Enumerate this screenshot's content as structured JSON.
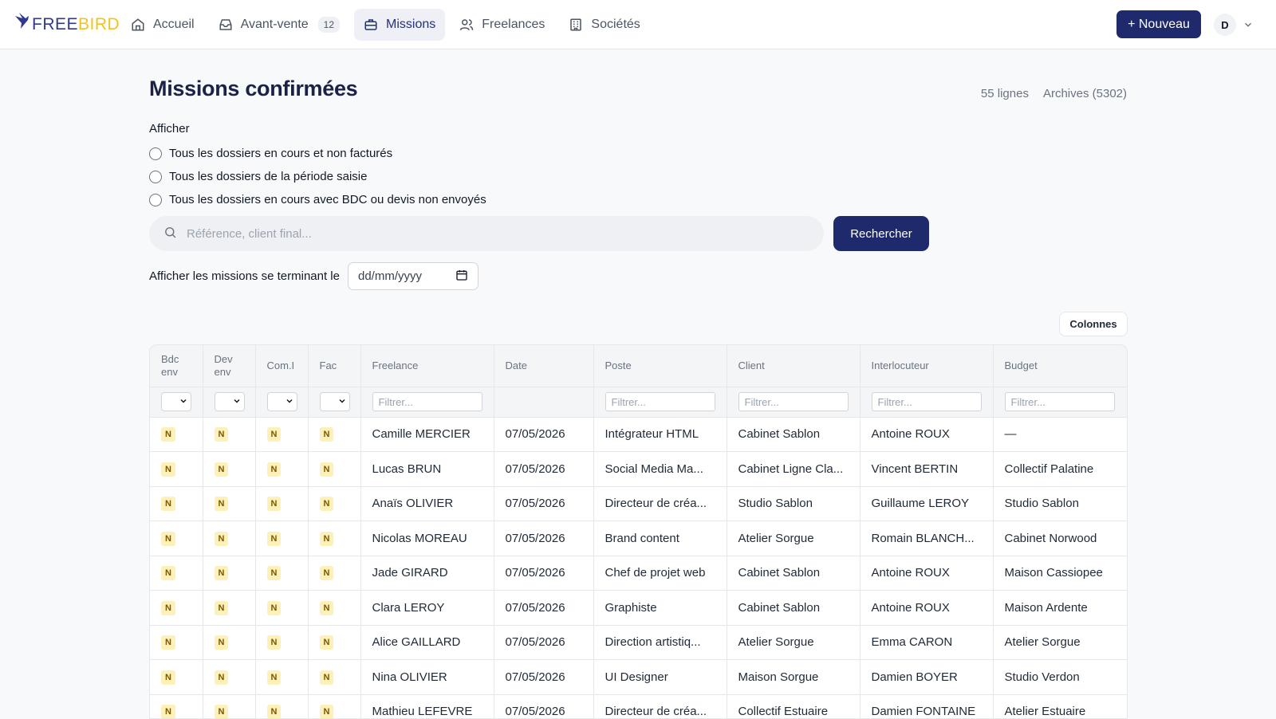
{
  "brand": {
    "free": "FREE",
    "bird": "BIRD"
  },
  "nav": {
    "items": [
      {
        "label": "Accueil",
        "icon": "home-icon"
      },
      {
        "label": "Avant-vente",
        "icon": "inbox-icon",
        "badge": "12"
      },
      {
        "label": "Missions",
        "icon": "briefcase-icon",
        "active": true
      },
      {
        "label": "Freelances",
        "icon": "users-icon"
      },
      {
        "label": "Sociétés",
        "icon": "building-icon"
      }
    ],
    "new_button": "+ Nouveau",
    "avatar": "D"
  },
  "page": {
    "title": "Missions confirmées",
    "rows_count": "55 lignes",
    "archives": "Archives (5302)",
    "afficher": "Afficher",
    "radios": [
      "Tous les dossiers en cours et non facturés",
      "Tous les dossiers de la période saisie",
      "Tous les dossiers en cours avec BDC ou devis non envoyés"
    ],
    "search_placeholder": "Référence, client final...",
    "search_button": "Rechercher",
    "date_label": "Afficher les missions se terminant le",
    "date_placeholder": "dd/mm/yyyy",
    "columns_button": "Colonnes"
  },
  "table": {
    "headers": [
      "Bdc env",
      "Dev env",
      "Com.I",
      "Fac",
      "Freelance",
      "Date",
      "Poste",
      "Client",
      "Interlocuteur",
      "Budget"
    ],
    "filter_placeholder": "Filtrer...",
    "rows": [
      {
        "flags": [
          "N",
          "N",
          "N",
          "N"
        ],
        "freelance": "Camille MERCIER",
        "date": "07/05/2026",
        "poste": "Intégrateur HTML",
        "client": "Cabinet Sablon",
        "interlocuteur": "Antoine ROUX",
        "budget": "—"
      },
      {
        "flags": [
          "N",
          "N",
          "N",
          "N"
        ],
        "freelance": "Lucas BRUN",
        "date": "07/05/2026",
        "poste": "Social Media Ma...",
        "client": "Cabinet Ligne Cla...",
        "interlocuteur": "Vincent BERTIN",
        "budget": "Collectif Palatine"
      },
      {
        "flags": [
          "N",
          "N",
          "N",
          "N"
        ],
        "freelance": "Anaïs OLIVIER",
        "date": "07/05/2026",
        "poste": "Directeur de créa...",
        "client": "Studio Sablon",
        "interlocuteur": "Guillaume LEROY",
        "budget": "Studio Sablon"
      },
      {
        "flags": [
          "N",
          "N",
          "N",
          "N"
        ],
        "freelance": "Nicolas MOREAU",
        "date": "07/05/2026",
        "poste": "Brand content",
        "client": "Atelier Sorgue",
        "interlocuteur": "Romain BLANCH...",
        "budget": "Cabinet Norwood"
      },
      {
        "flags": [
          "N",
          "N",
          "N",
          "N"
        ],
        "freelance": "Jade GIRARD",
        "date": "07/05/2026",
        "poste": "Chef de projet web",
        "client": "Cabinet Sablon",
        "interlocuteur": "Antoine ROUX",
        "budget": "Maison Cassiopee"
      },
      {
        "flags": [
          "N",
          "N",
          "N",
          "N"
        ],
        "freelance": "Clara LEROY",
        "date": "07/05/2026",
        "poste": "Graphiste",
        "client": "Cabinet Sablon",
        "interlocuteur": "Antoine ROUX",
        "budget": "Maison Ardente"
      },
      {
        "flags": [
          "N",
          "N",
          "N",
          "N"
        ],
        "freelance": "Alice GAILLARD",
        "date": "07/05/2026",
        "poste": "Direction artistiq...",
        "client": "Atelier Sorgue",
        "interlocuteur": "Emma CARON",
        "budget": "Atelier Sorgue"
      },
      {
        "flags": [
          "N",
          "N",
          "N",
          "N"
        ],
        "freelance": "Nina OLIVIER",
        "date": "07/05/2026",
        "poste": "UI Designer",
        "client": "Maison Sorgue",
        "interlocuteur": "Damien BOYER",
        "budget": "Studio Verdon"
      },
      {
        "flags": [
          "N",
          "N",
          "N",
          "N"
        ],
        "freelance": "Mathieu LEFEVRE",
        "date": "07/05/2026",
        "poste": "Directeur de créa...",
        "client": "Collectif Estuaire",
        "interlocuteur": "Damien FONTAINE",
        "budget": "Atelier Estuaire"
      }
    ]
  }
}
